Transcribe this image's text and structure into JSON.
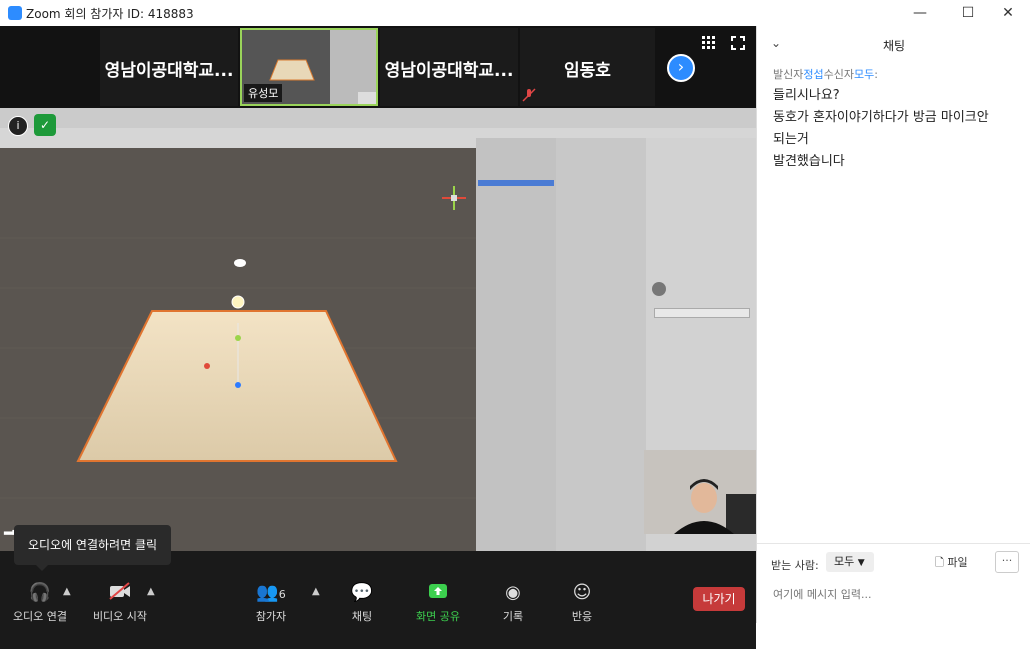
{
  "window": {
    "title": "Zoom 회의 참가자 ID: 418883",
    "minimize": "—",
    "maximize": "☐",
    "close": "✕"
  },
  "participants_strip": {
    "tiles": [
      {
        "name": "영남이공대학교..."
      },
      {
        "name": "유성모"
      },
      {
        "name": "영남이공대학교..."
      },
      {
        "name": "임동호"
      }
    ],
    "next_icon": "chevron-right-icon",
    "grid_icon": "grid-view-icon",
    "fullscreen_icon": "fullscreen-icon"
  },
  "share": {
    "info_icon": "i",
    "shield_icon": "✓",
    "signal_label": "유성모",
    "tooltip": "오디오에 연결하려면 클릭"
  },
  "toolbar": {
    "audio": "오디오 연결",
    "video": "비디오 시작",
    "participants_count": "6",
    "participants": "참가자",
    "chat": "채팅",
    "share": "화면 공유",
    "record": "기록",
    "reactions": "반응",
    "leave": "나가기",
    "colors": {
      "share_green": "#3ccf4e",
      "leave_red": "#c63a3a"
    }
  },
  "chat": {
    "title": "채팅",
    "sender_prefix": "발신자",
    "sender": "정섭",
    "recipient_prefix": "수신자",
    "recipient": "모두",
    "colon": ":",
    "messages": [
      "들리시나요?",
      "동호가 혼자이야기하다가 방금 마이크안",
      "되는거",
      "발견했습니다"
    ],
    "to_label": "받는 사람:",
    "to_value": "모두",
    "file_label": "파일",
    "more_label": "···",
    "input_placeholder": "여기에 메시지 입력..."
  }
}
